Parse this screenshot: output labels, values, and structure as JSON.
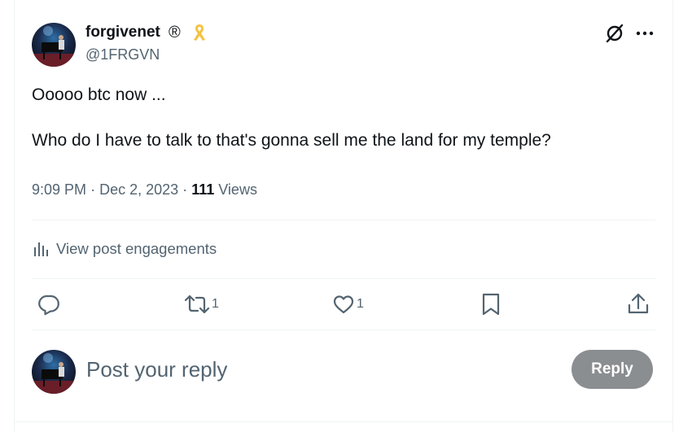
{
  "author": {
    "display_name": "forgivenet",
    "registered_mark": "®",
    "badge_icon": "ribbon-icon",
    "handle": "@1FRGVN"
  },
  "post": {
    "lines": [
      "Ooooo btc now ...",
      "Who do I have to talk to that's gonna sell me the land for my temple?"
    ],
    "time": "9:09 PM",
    "date": "Dec 2, 2023",
    "views_count": "111",
    "views_label": "Views",
    "separator": "·"
  },
  "engagements_label": "View post engagements",
  "actions": {
    "reply_count": "",
    "repost_count": "1",
    "like_count": "1"
  },
  "composer": {
    "placeholder": "Post your reply",
    "button_label": "Reply"
  },
  "colors": {
    "text_primary": "#0f1419",
    "text_secondary": "#536471",
    "divider": "#eff3f4",
    "reply_button_disabled": "#8b8e91",
    "ribbon": "#f5c242"
  }
}
